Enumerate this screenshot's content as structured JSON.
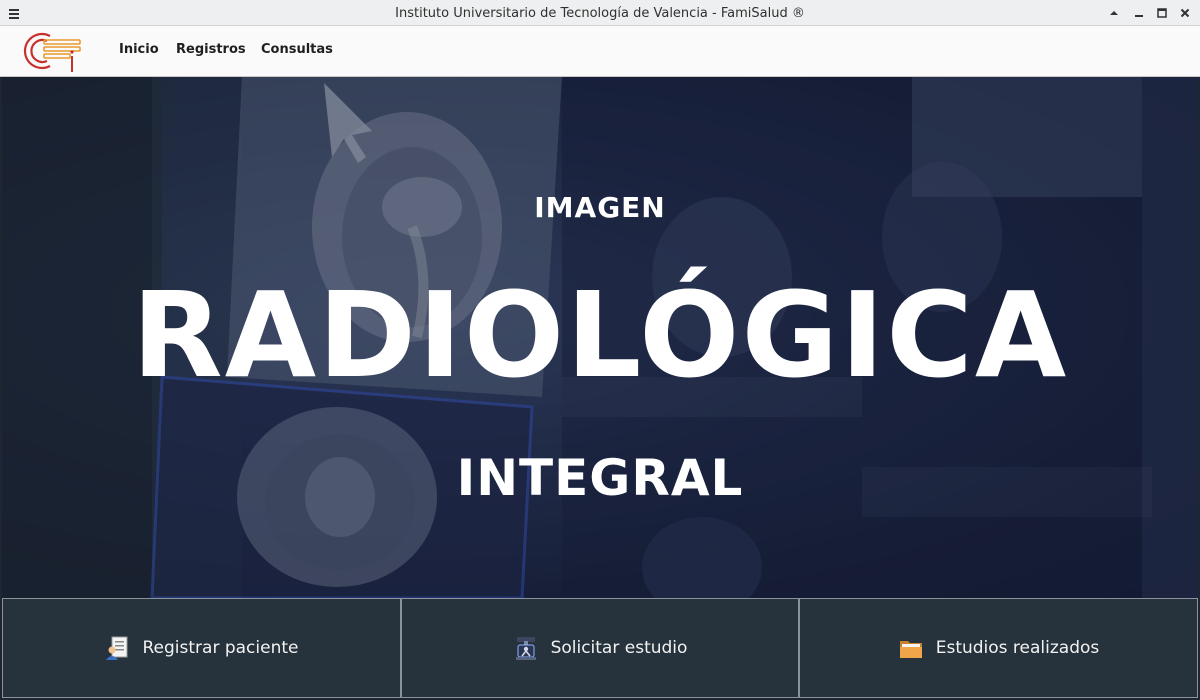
{
  "window": {
    "title": "Instituto Universitario de Tecnología de Valencia - FamiSalud ®",
    "menu_icon": "hamburger-icon",
    "controls": [
      "keep-above-icon",
      "minimize-icon",
      "maximize-icon",
      "close-icon"
    ]
  },
  "menubar": {
    "logo_icon": "institute-logo-icon",
    "items": [
      {
        "label": "Inicio"
      },
      {
        "label": "Registros"
      },
      {
        "label": "Consultas"
      }
    ]
  },
  "hero": {
    "line1": "IMAGEN",
    "line2": "RADIOLÓGICA",
    "line3": "INTEGRAL"
  },
  "actions": [
    {
      "label": "Registrar paciente",
      "icon": "patient-record-icon"
    },
    {
      "label": "Solicitar estudio",
      "icon": "xray-machine-icon"
    },
    {
      "label": "Estudios realizados",
      "icon": "folder-icon"
    }
  ],
  "colors": {
    "titlebar_bg": "#eeeff0",
    "menubar_bg": "#fafafa",
    "hero_tint": "#18203c",
    "button_bg": "#26333c",
    "button_border": "#8a929c",
    "logo_red": "#c8302c",
    "logo_orange": "#e89a2c",
    "text_light": "#ffffff"
  }
}
